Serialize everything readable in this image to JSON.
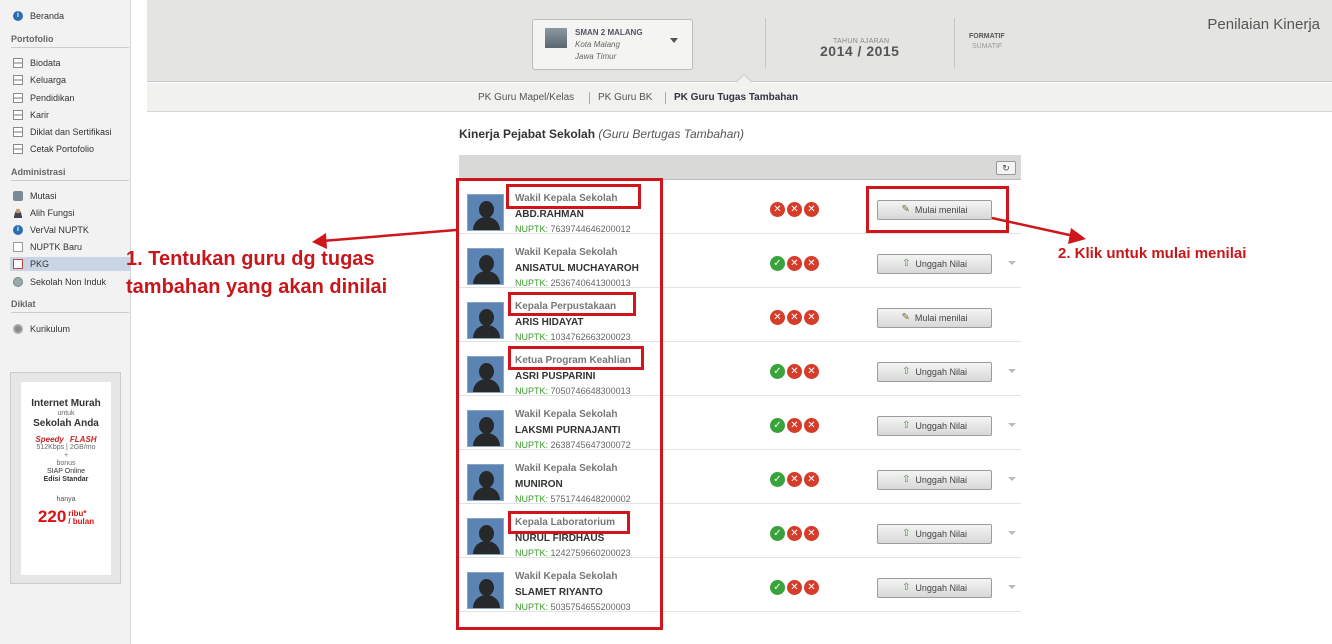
{
  "sidebar": {
    "items_top": [
      {
        "label": "Beranda",
        "icon": "info-icon"
      }
    ],
    "section_portofolio": "Portofolio",
    "portofolio_items": [
      {
        "label": "Biodata"
      },
      {
        "label": "Keluarga"
      },
      {
        "label": "Pendidikan"
      },
      {
        "label": "Karir"
      },
      {
        "label": "Diklat dan Sertifikasi"
      },
      {
        "label": "Cetak Portofolio"
      }
    ],
    "section_administrasi": "Administrasi",
    "administrasi_items": [
      {
        "label": "Mutasi"
      },
      {
        "label": "Alih Fungsi"
      },
      {
        "label": "VerVal NUPTK"
      },
      {
        "label": "NUPTK Baru"
      },
      {
        "label": "PKG",
        "active": true
      },
      {
        "label": "Sekolah Non Induk"
      }
    ],
    "section_diklat": "Diklat",
    "diklat_items": [
      {
        "label": "Kurikulum"
      }
    ]
  },
  "ad": {
    "line1": "Internet Murah",
    "line2": "untuk",
    "line3": "Sekolah Anda",
    "brand1": "Speedy",
    "brand2": "FLASH",
    "brand1_spec": "512Kbps",
    "brand2_spec": "2GB/mo",
    "plus": "+",
    "bonus": "bonus",
    "product": "SIAP Online",
    "edition": "Edisi Standar",
    "hanya": "hanya",
    "price": "220",
    "price_unit": "ribu*",
    "price_per": "/ bulan"
  },
  "header": {
    "school_name": "SMAN 2 MALANG",
    "school_city": "Kota Malang",
    "school_province": "Jawa Timur",
    "tahun_ajaran_label": "TAHUN AJARAN",
    "tahun_ajaran_value": "2014 / 2015",
    "formatif": "FORMATIF",
    "sumatif": "SUMATIF",
    "page_title": "Penilaian Kinerja"
  },
  "tabs": [
    {
      "label": "PK Guru Mapel/Kelas"
    },
    {
      "label": "PK Guru BK"
    },
    {
      "label": "PK Guru Tugas Tambahan",
      "active": true
    }
  ],
  "content": {
    "title": "Kinerja Pejabat Sekolah",
    "subtitle": "(Guru Bertugas Tambahan)",
    "refresh_icon": "↻",
    "nuptk_label": "NUPTK:"
  },
  "teachers": [
    {
      "role": "Wakil Kepala Sekolah",
      "name": "ABD.RAHMAN",
      "nuptk": "7639744646200012",
      "status": [
        "no",
        "no",
        "no"
      ],
      "button": "Mulai menilai",
      "button_icon": "pencil-icon",
      "dropdown": false
    },
    {
      "role": "Wakil Kepala Sekolah",
      "name": "ANISATUL MUCHAYAROH",
      "nuptk": "2536740641300013",
      "status": [
        "ok",
        "no",
        "no"
      ],
      "button": "Unggah Nilai",
      "button_icon": "upload-arrow-icon",
      "dropdown": true
    },
    {
      "role": "Kepala Perpustakaan",
      "name": "ARIS HIDAYAT",
      "nuptk": "1034762663200023",
      "status": [
        "no",
        "no",
        "no"
      ],
      "button": "Mulai menilai",
      "button_icon": "pencil-icon",
      "dropdown": false
    },
    {
      "role": "Ketua Program Keahlian",
      "name": "ASRI PUSPARINI",
      "nuptk": "7050746648300013",
      "status": [
        "ok",
        "no",
        "no"
      ],
      "button": "Unggah Nilai",
      "button_icon": "upload-arrow-icon",
      "dropdown": true
    },
    {
      "role": "Wakil Kepala Sekolah",
      "name": "LAKSMI PURNAJANTI",
      "nuptk": "2638745647300072",
      "status": [
        "ok",
        "no",
        "no"
      ],
      "button": "Unggah Nilai",
      "button_icon": "upload-arrow-icon",
      "dropdown": true
    },
    {
      "role": "Wakil Kepala Sekolah",
      "name": "MUNIRON",
      "nuptk": "5751744648200002",
      "status": [
        "ok",
        "no",
        "no"
      ],
      "button": "Unggah Nilai",
      "button_icon": "upload-arrow-icon",
      "dropdown": true
    },
    {
      "role": "Kepala Laboratorium",
      "name": "NURUL FIRDHAUS",
      "nuptk": "1242759660200023",
      "status": [
        "ok",
        "no",
        "no"
      ],
      "button": "Unggah Nilai",
      "button_icon": "upload-arrow-icon",
      "dropdown": true
    },
    {
      "role": "Wakil Kepala Sekolah",
      "name": "SLAMET RIYANTO",
      "nuptk": "5035754655200003",
      "status": [
        "ok",
        "no",
        "no"
      ],
      "button": "Unggah Nilai",
      "button_icon": "upload-arrow-icon",
      "dropdown": true
    }
  ],
  "annotations": {
    "step1_line1": "1. Tentukan guru dg tugas",
    "step1_line2": "tambahan yang akan dinilai",
    "step2": "2. Klik untuk mulai menilai"
  },
  "colors": {
    "annotation_red": "#d0161b",
    "ok_green": "#3aa23a",
    "no_red": "#d63c2a",
    "nuptk_green": "#3a9a2b"
  }
}
